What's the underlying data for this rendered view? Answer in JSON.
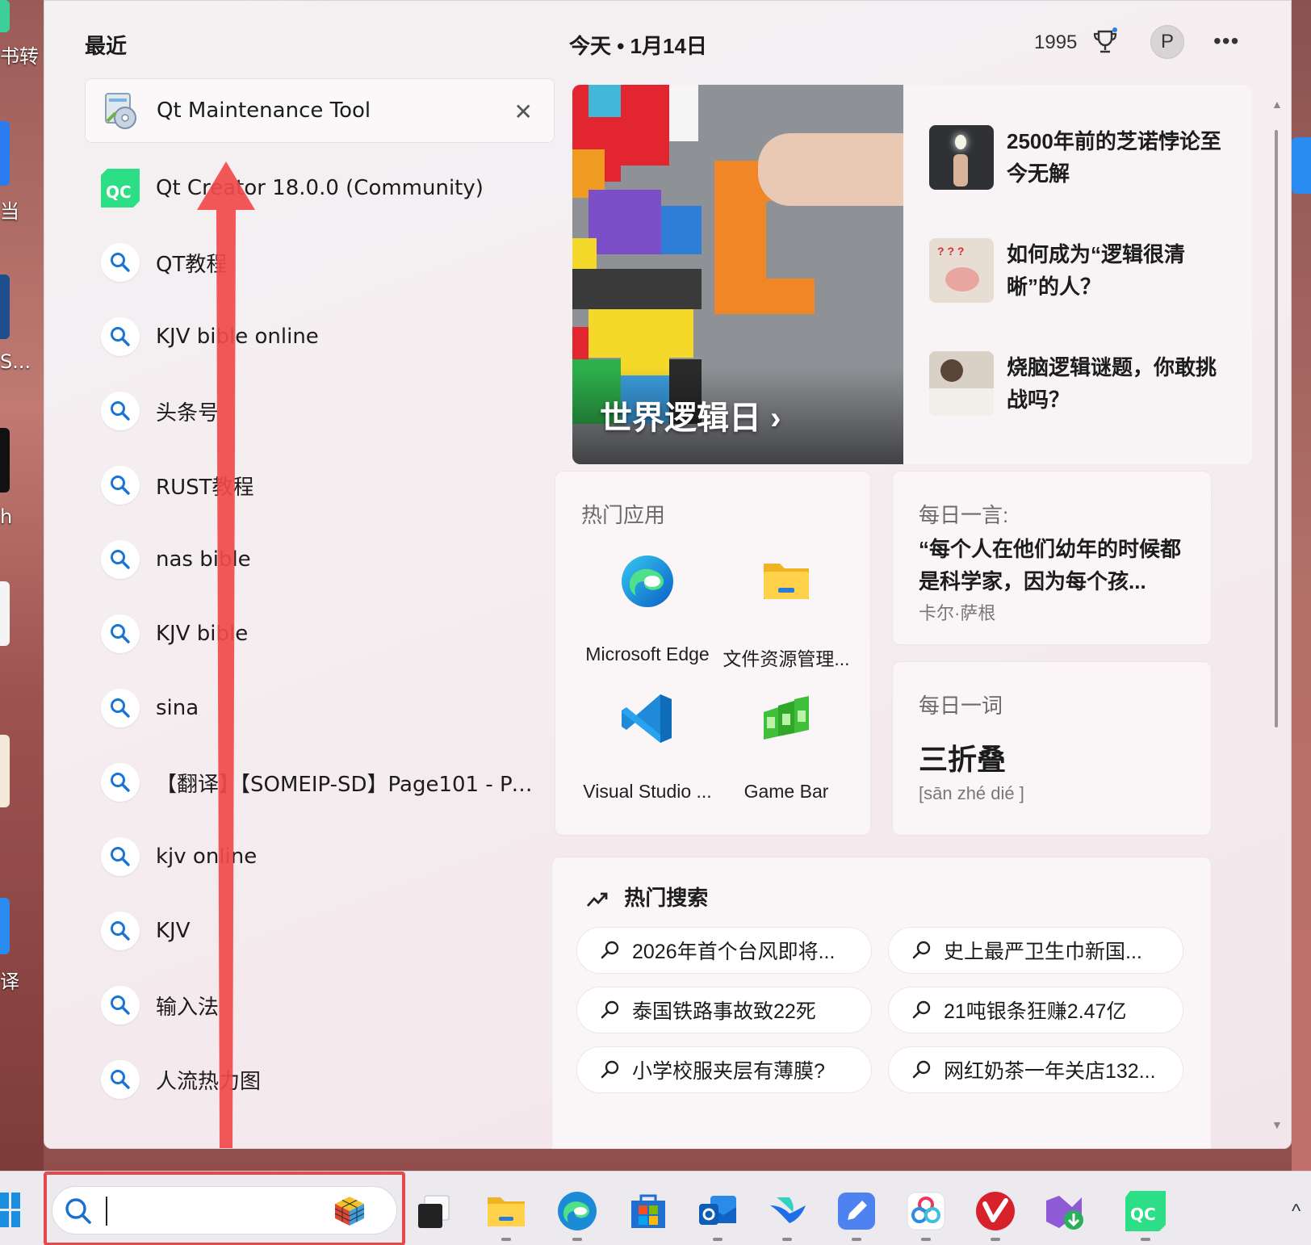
{
  "desktop": {
    "left_fragments": [
      "书转",
      "当",
      "S...",
      "h",
      "译"
    ],
    "right_icon": "app-icon"
  },
  "header": {
    "recent_title": "最近",
    "today_label": "今天 • 1月14日",
    "points": "1995",
    "avatar_letter": "P",
    "more_label": "•••"
  },
  "recent": [
    {
      "label": "Qt Maintenance Tool",
      "icon": "qt-maintenance-icon",
      "active": true,
      "close": "✕"
    },
    {
      "label": "Qt Creator 18.0.0 (Community)",
      "icon": "qt-creator-icon"
    },
    {
      "label": "QT教程",
      "icon": "search-icon"
    },
    {
      "label": "KJV bible online",
      "icon": "search-icon"
    },
    {
      "label": "头条号",
      "icon": "search-icon"
    },
    {
      "label": "RUST教程",
      "icon": "search-icon"
    },
    {
      "label": "nas bible",
      "icon": "search-icon"
    },
    {
      "label": "KJV bible",
      "icon": "search-icon"
    },
    {
      "label": "sina",
      "icon": "search-icon"
    },
    {
      "label": "【翻译】【SOMEIP-SD】Page101 - Pa...",
      "icon": "search-icon"
    },
    {
      "label": "kjv online",
      "icon": "search-icon"
    },
    {
      "label": "KJV",
      "icon": "search-icon"
    },
    {
      "label": "输入法",
      "icon": "search-icon"
    },
    {
      "label": "人流热力图",
      "icon": "search-icon"
    }
  ],
  "feature": {
    "hero_title": "世界逻辑日",
    "hero_chevron": "›",
    "news": [
      {
        "title": "2500年前的芝诺悖论至今无解"
      },
      {
        "title": "如何成为“逻辑很清晰”的人？"
      },
      {
        "title": "烧脑逻辑谜题，你敢挑战吗？"
      }
    ]
  },
  "hot_apps": {
    "title": "热门应用",
    "apps": [
      {
        "label": "Microsoft Edge",
        "icon": "edge-icon"
      },
      {
        "label": "文件资源管理...",
        "icon": "file-explorer-icon"
      },
      {
        "label": "Visual Studio ...",
        "icon": "vscode-icon"
      },
      {
        "label": "Game Bar",
        "icon": "game-bar-icon"
      }
    ]
  },
  "daily_quote": {
    "title": "每日一言:",
    "text": "“每个人在他们幼年的时候都是科学家，因为每个孩...",
    "author": "卡尔·萨根"
  },
  "daily_word": {
    "title": "每日一词",
    "word": "三折叠",
    "pinyin": "[sān zhé dié ]"
  },
  "hot_search": {
    "title": "热门搜索",
    "items": [
      "2026年首个台风即将...",
      "史上最严卫生巾新国...",
      "泰国铁路事故致22死",
      "21吨银条狂赚2.47亿",
      "小学校服夹层有薄膜?",
      "网红奶茶一年关店132..."
    ]
  },
  "scrollbar": {
    "up": "▲",
    "down": "▼"
  },
  "taskbar": {
    "search_placeholder": "",
    "chevron": "^",
    "colors": {
      "highlight": "#e5484d",
      "arrow": "#f04a4a"
    }
  }
}
